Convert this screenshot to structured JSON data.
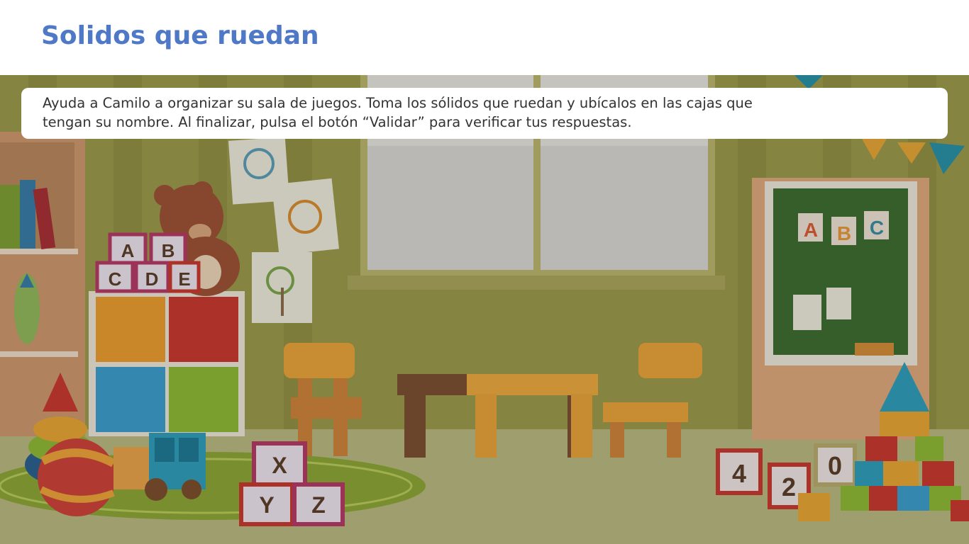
{
  "header": {
    "title": "Solidos que ruedan"
  },
  "instruction": {
    "line1": "Ayuda a Camilo a organizar su sala de juegos. Toma los sólidos que ruedan y ubícalos en las cajas que",
    "line2": "tengan su nombre. Al finalizar, pulsa el botón “Validar” para verificar tus respuestas."
  },
  "scene": {
    "blocks_left_top": [
      "A",
      "B"
    ],
    "blocks_left_bottom": [
      "C",
      "D",
      "E"
    ],
    "blocks_xy": [
      "X",
      "Y",
      "Z"
    ],
    "number_blocks": [
      "4",
      "2",
      "0"
    ],
    "board_letters": [
      "A",
      "B",
      "C"
    ]
  },
  "colors": {
    "title": "#4f79c6",
    "wall": "#9a9a45",
    "floor": "#b7b67c",
    "rug": "#8aa235",
    "board": "#3d6b31"
  }
}
